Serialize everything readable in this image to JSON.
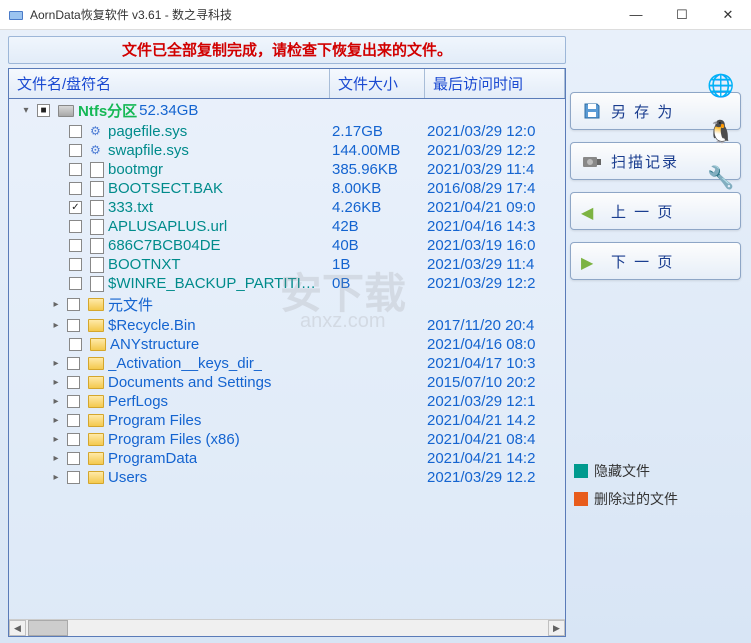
{
  "titlebar": {
    "title": "AornData恢复软件 v3.61    - 数之寻科技"
  },
  "status": "文件已全部复制完成，请检查下恢复出来的文件。",
  "columns": {
    "name": "文件名/盘符名",
    "size": "文件大小",
    "date": "最后访问时间"
  },
  "root": {
    "name": "Ntfs分区",
    "size": "52.34GB"
  },
  "files": [
    {
      "name": "pagefile.sys",
      "size": "2.17GB",
      "date": "2021/03/29 12:0",
      "type": "sys"
    },
    {
      "name": "swapfile.sys",
      "size": "144.00MB",
      "date": "2021/03/29 12:2",
      "type": "sys"
    },
    {
      "name": "bootmgr",
      "size": "385.96KB",
      "date": "2021/03/29 11:4",
      "type": "doc"
    },
    {
      "name": "BOOTSECT.BAK",
      "size": "8.00KB",
      "date": "2016/08/29 17:4",
      "type": "doc"
    },
    {
      "name": "333.txt",
      "size": "4.26KB",
      "date": "2021/04/21 09:0",
      "type": "doc",
      "checked": true
    },
    {
      "name": "APLUSAPLUS.url",
      "size": "42B",
      "date": "2021/04/16 14:3",
      "type": "doc"
    },
    {
      "name": "686C7BCB04DE",
      "size": "40B",
      "date": "2021/03/19 16:0",
      "type": "doc"
    },
    {
      "name": "BOOTNXT",
      "size": "1B",
      "date": "2021/03/29 11:4",
      "type": "doc"
    },
    {
      "name": "$WINRE_BACKUP_PARTITI…",
      "size": "0B",
      "date": "2021/03/29 12:2",
      "type": "doc"
    }
  ],
  "folders": [
    {
      "name": "元文件",
      "date": ""
    },
    {
      "name": "$Recycle.Bin",
      "date": "2017/11/20 20:4"
    },
    {
      "name": "ANYstructure",
      "date": "2021/04/16 08:0"
    },
    {
      "name": "_Activation__keys_dir_",
      "date": "2021/04/17 10:3"
    },
    {
      "name": "Documents and Settings",
      "date": "2015/07/10 20:2"
    },
    {
      "name": "PerfLogs",
      "date": "2021/03/29 12:1"
    },
    {
      "name": "Program Files",
      "date": "2021/04/21 14.2"
    },
    {
      "name": "Program Files (x86)",
      "date": "2021/04/21 08:4"
    },
    {
      "name": "ProgramData",
      "date": "2021/04/21 14:2"
    },
    {
      "name": "Users",
      "date": "2021/03/29 12.2"
    }
  ],
  "buttons": {
    "saveas": "另 存 为",
    "scanlog": "扫描记录",
    "prev": "上 一 页",
    "next": "下 一 页"
  },
  "legend": {
    "hidden": "隐藏文件",
    "deleted": "删除过的文件"
  },
  "colors": {
    "hidden": "#009a8e",
    "deleted": "#e85c1c"
  },
  "watermark": "安下载",
  "watermark_sub": "anxz.com"
}
